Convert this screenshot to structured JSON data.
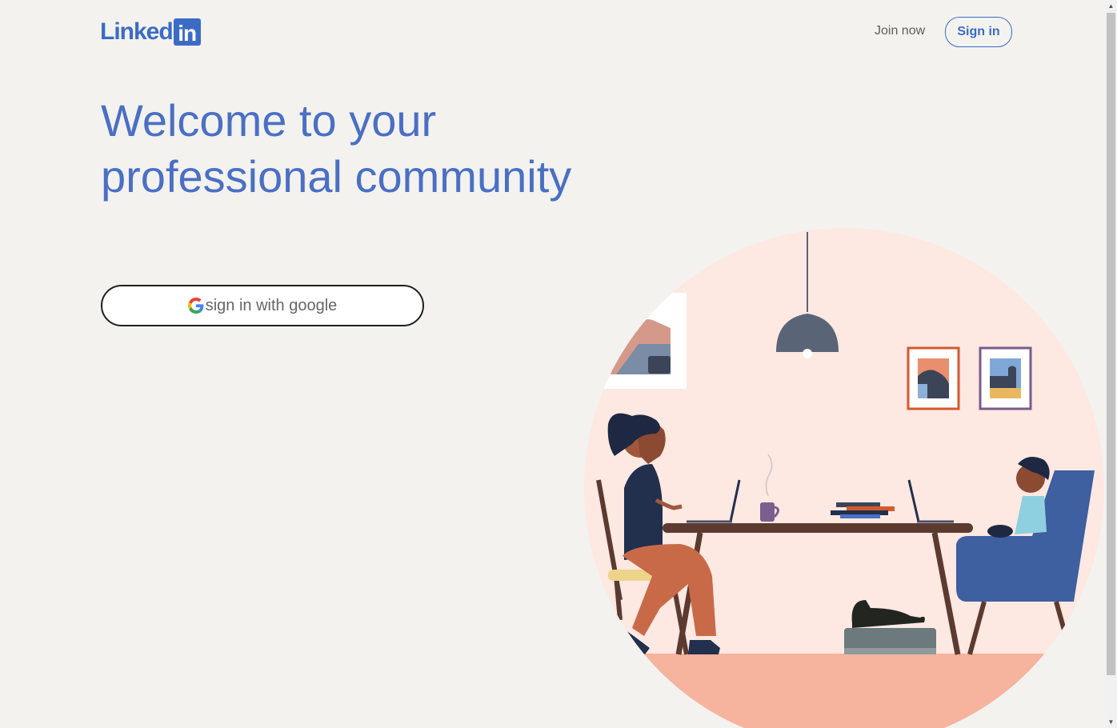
{
  "header": {
    "logo_text": "Linked",
    "logo_box_text": "in",
    "join_label": "Join now",
    "signin_label": "Sign in"
  },
  "hero": {
    "headline": "Welcome to your professional community",
    "google_button_label": "sign in with google"
  },
  "colors": {
    "brand": "#3b6cc5",
    "headline": "#4a6fc4",
    "background": "#f3f2ef"
  },
  "icons": {
    "google": "google-icon",
    "scroll_up": "arrow-up-icon",
    "scroll_down": "arrow-down-icon"
  }
}
